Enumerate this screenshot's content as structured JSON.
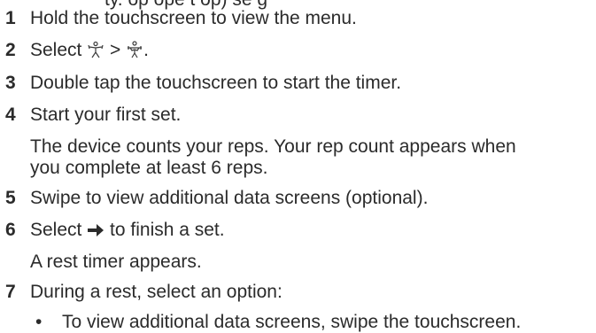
{
  "truncated_top_line": "ty.   op   ope      t   op)   se  g",
  "steps": [
    {
      "num": "1",
      "text": "Hold the touchscreen to view the menu."
    },
    {
      "num": "2",
      "pre": "Select ",
      "mid": " > ",
      "post": ".",
      "icons": [
        "person-activity-icon",
        "strength-workout-icon"
      ]
    },
    {
      "num": "3",
      "text": "Double tap the touchscreen to start the timer."
    },
    {
      "num": "4",
      "text": "Start your first set."
    },
    {
      "num": "5",
      "text": "Swipe to view additional data screens (optional)."
    },
    {
      "num": "6",
      "pre": "Select ",
      "post": " to finish a set.",
      "icons": [
        "arrow-right-icon"
      ]
    },
    {
      "num": "7",
      "text": "During a rest, select an option:"
    }
  ],
  "step4_note_line1": "The device counts your reps. Your rep count appears when",
  "step4_note_line2": "you complete at least 6 reps.",
  "step6_note": "A rest timer appears.",
  "step7_bullet": "To view additional data screens, swipe the touchscreen."
}
